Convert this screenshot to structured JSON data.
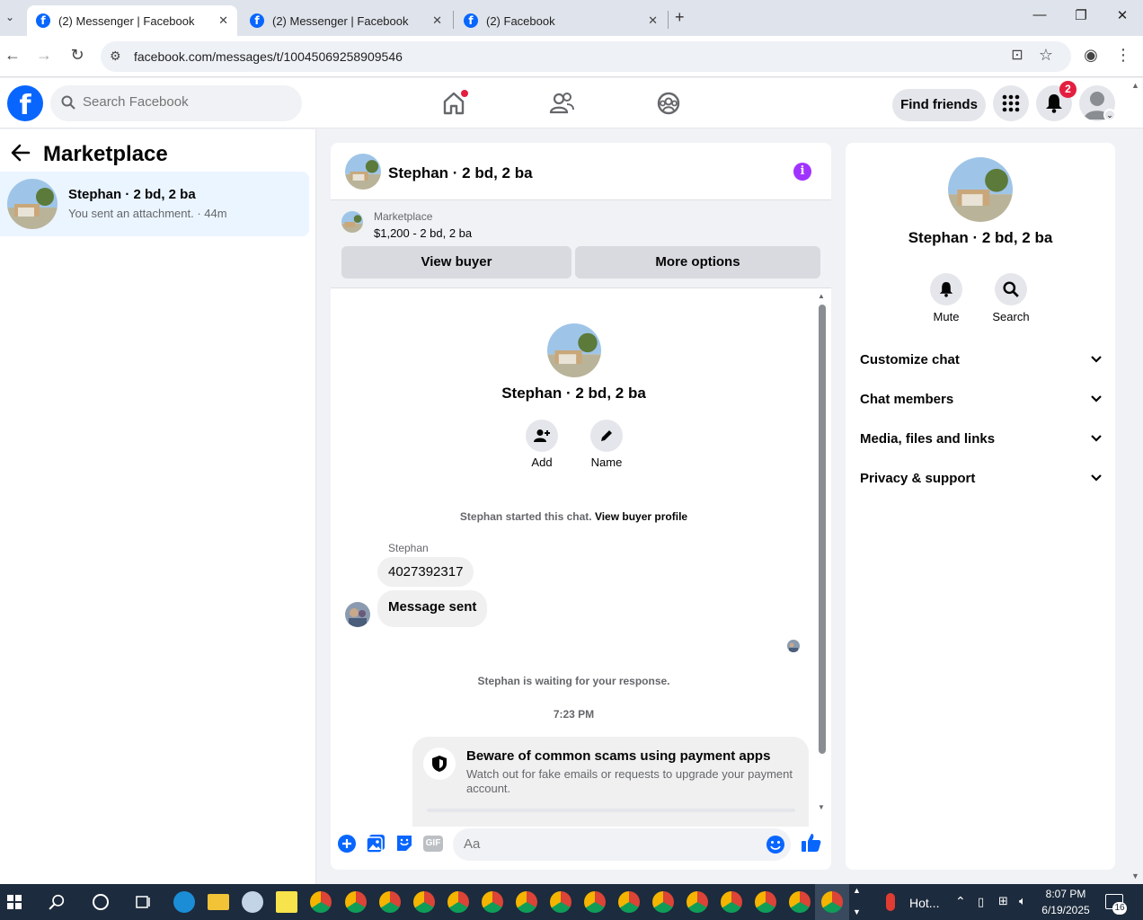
{
  "browser": {
    "tabs": [
      {
        "title": "(2) Messenger | Facebook"
      },
      {
        "title": "(2) Messenger | Facebook"
      },
      {
        "title": "(2) Facebook"
      }
    ],
    "url": "facebook.com/messages/t/10045069258909546"
  },
  "header": {
    "logo": "f",
    "search_placeholder": "Search Facebook",
    "find_friends": "Find friends",
    "notification_count": "2"
  },
  "left": {
    "title": "Marketplace",
    "conversation": {
      "name": "Stephan · 2 bd, 2 ba",
      "preview": "You sent an attachment. · 44m"
    }
  },
  "chat": {
    "title": "Stephan · 2 bd, 2 ba",
    "marketplace_label": "Marketplace",
    "listing": "$1,200 - 2 bd, 2 ba",
    "view_buyer": "View buyer",
    "more_options": "More options",
    "profile_name": "Stephan · 2 bd, 2 ba",
    "add_label": "Add",
    "name_label": "Name",
    "started": "Stephan started this chat.",
    "view_buyer_profile": "View buyer profile",
    "sender": "Stephan",
    "msg1": "4027392317",
    "msg2": "Message sent",
    "waiting": "Stephan is waiting for your response.",
    "time": "7:23 PM",
    "scam_title": "Beware of common scams using payment apps",
    "scam_desc": "Watch out for fake emails or requests to upgrade your payment account.",
    "composer_placeholder": "Aa",
    "gif": "GIF"
  },
  "right": {
    "name": "Stephan · 2 bd, 2 ba",
    "mute": "Mute",
    "search": "Search",
    "sections": [
      "Customize chat",
      "Chat members",
      "Media, files and links",
      "Privacy & support"
    ]
  },
  "taskbar": {
    "weather": "Hot...",
    "time": "8:07 PM",
    "date": "6/19/2025",
    "notif": "16"
  },
  "colors": {
    "fb_blue": "#0866ff",
    "accent_purple": "#a033ff",
    "badge_red": "#e41e3f"
  }
}
